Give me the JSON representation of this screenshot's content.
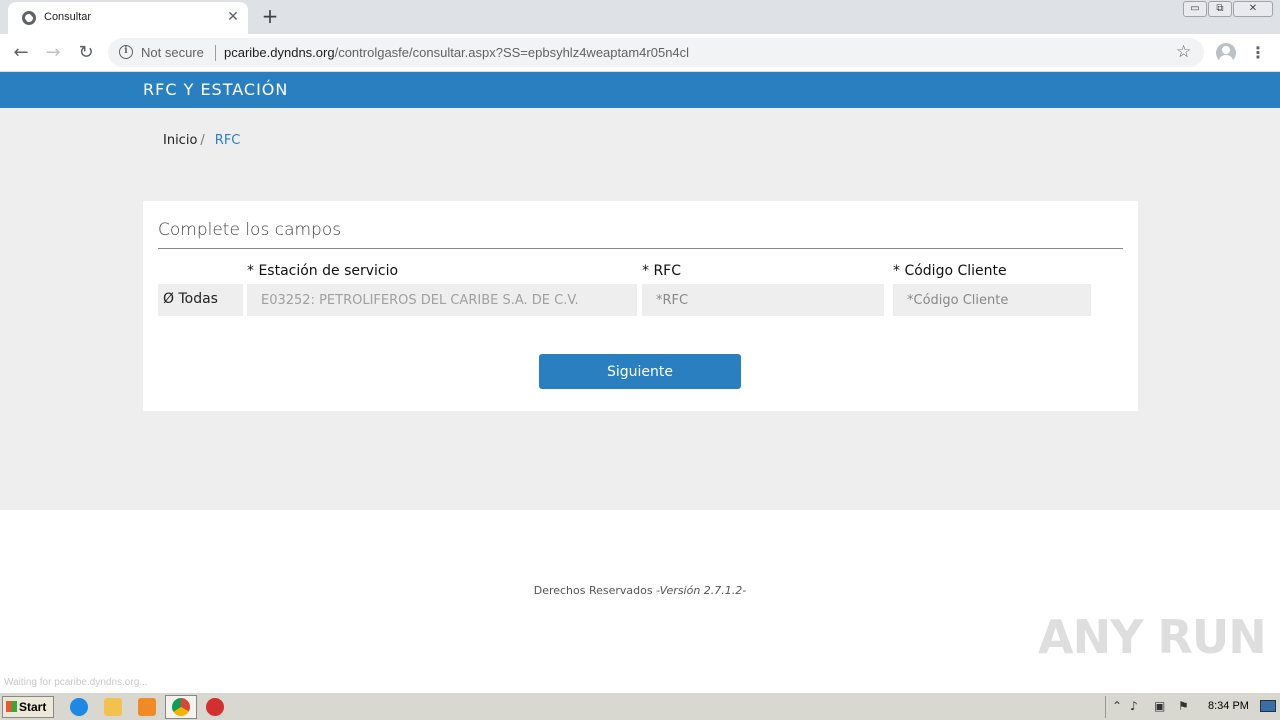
{
  "browser": {
    "tab_title": "Consultar",
    "tab_close": "✕",
    "new_tab": "+",
    "security_label": "Not secure",
    "url_host": "pcaribe.dyndns.org",
    "url_path": "/controlgasfe/consultar.aspx?SS=epbsyhlz4weaptam4r05n4cl",
    "window_controls": [
      "▭",
      "⧉",
      "✕"
    ],
    "status_text": "Waiting for pcaribe.dyndns.org..."
  },
  "header": {
    "title": "RFC Y ESTACIÓN"
  },
  "breadcrumb": {
    "home": "Inicio",
    "separator": "/",
    "current": "RFC"
  },
  "form": {
    "title": "Complete los campos",
    "station_label": "* Estación de servicio",
    "station_addon": "Ø Todas",
    "station_value": "E03252: PETROLIFEROS DEL CARIBE S.A. DE C.V.",
    "rfc_label": "* RFC",
    "rfc_placeholder": "*RFC",
    "client_label": "* Código Cliente",
    "client_placeholder": "*Código Cliente",
    "submit_label": "Siguiente"
  },
  "footer": {
    "rights": "Derechos Reservados",
    "version": "-Versión 2.7.1.2-"
  },
  "watermark": "ANY RUN",
  "taskbar": {
    "start_label": "Start",
    "clock": "8:34 PM"
  },
  "colors": {
    "header_blue": "#2a7fc1",
    "page_gray": "#eeeeee"
  }
}
